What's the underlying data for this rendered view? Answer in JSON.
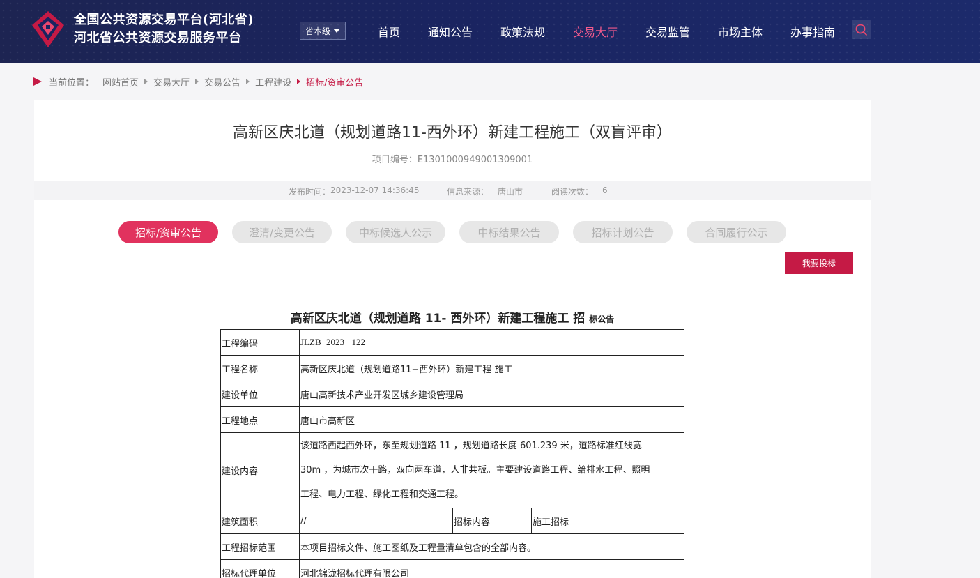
{
  "header": {
    "title_line1": "全国公共资源交易平台(河北省)",
    "title_line2": "河北省公共资源交易服务平台",
    "level_select": "省本级",
    "nav": [
      "首页",
      "通知公告",
      "政策法规",
      "交易大厅",
      "交易监管",
      "市场主体",
      "办事指南"
    ],
    "active_nav": "交易大厅",
    "colors": {
      "accent": "#c51a45",
      "active_nav": "#f25a8d",
      "header_bg": "#1a2460"
    }
  },
  "breadcrumb": {
    "prefix": "当前位置：",
    "items": [
      "网站首页",
      "交易大厅",
      "交易公告",
      "工程建设"
    ],
    "current": "招标/资审公告"
  },
  "article": {
    "title": "高新区庆北道（规划道路11-西外环）新建工程施工（双盲评审）",
    "project_no": "项目编号：E1301000949001309001",
    "publish_label": "发布时间：",
    "publish_time": "2023-12-07 14:36:45",
    "source_label": "信息来源：",
    "source": "唐山市",
    "views_label": "阅读次数：",
    "views": "6"
  },
  "tabs": [
    "招标/资审公告",
    "澄清/变更公告",
    "中标候选人公示",
    "中标结果公告",
    "招标计划公告",
    "合同履行公示"
  ],
  "active_tab": "招标/资审公告",
  "bid_button": "我要投标",
  "notice": {
    "title_main": "高新区庆北道（规划道路 11- 西外环）新建工程施工 招",
    "title_small": "标公告",
    "rows": {
      "code_label": "工程编码",
      "code_value": "JLZB−2023− 122",
      "name_label": "工程名称",
      "name_value": "高新区庆北道（规划道路11−西外环）新建工程 施工",
      "owner_label": "建设单位",
      "owner_value": "唐山高新技术产业开发区城乡建设管理局",
      "site_label": "工程地点",
      "site_value": "唐山市高新区",
      "content_label": "建设内容",
      "content_line1": "该道路西起西外环，东至规划道路 11 ，规划道路长度 601.239 米，道路标准红线宽",
      "content_line2": "30m ，为城市次干路，双向两车道，人非共板。主要建设道路工程、给排水工程、照明",
      "content_line3": "工程、电力工程、绿化工程和交通工程。",
      "area_label": "建筑面积",
      "area_value": "//",
      "bidcontent_label": "招标内容",
      "bidcontent_value": "施工招标",
      "scope_label": "工程招标范围",
      "scope_value": "本项目招标文件、施工图纸及工程量清单包含的全部内容。",
      "agent_label": "招标代理单位",
      "agent_value": "河北锦泷招标代理有限公司"
    }
  }
}
